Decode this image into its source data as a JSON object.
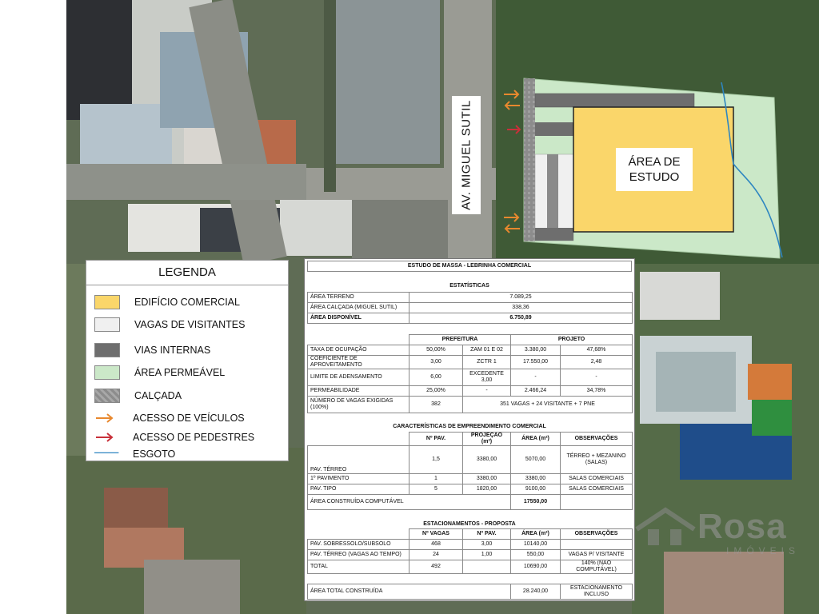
{
  "map": {
    "road_label": "AV. MIGUEL SUTIL",
    "study_area_label_line1": "ÁREA DE",
    "study_area_label_line2": "ESTUDO"
  },
  "colors": {
    "commercial_building": "#FAD66A",
    "visitor_parking": "#F0F0F0",
    "internal_roads": "#6E6E6E",
    "permeable_area": "#CBE8C8",
    "sidewalk": "#8C8C8C",
    "vehicle_access": "#E8882E",
    "pedestrian_access": "#C8303A",
    "sewer": "#2E86C1"
  },
  "legend": {
    "title": "LEGENDA",
    "items": [
      {
        "label": "EDIFÍCIO COMERCIAL",
        "kind": "swatch",
        "color": "#FAD66A"
      },
      {
        "label": "VAGAS DE VISITANTES",
        "kind": "swatch",
        "color": "#F0F0F0"
      },
      {
        "label": "VIAS INTERNAS",
        "kind": "swatch",
        "color": "#6E6E6E"
      },
      {
        "label": "ÁREA PERMEÁVEL",
        "kind": "swatch",
        "color": "#CBE8C8"
      },
      {
        "label": "CALÇADA",
        "kind": "swatch",
        "color": "#8C8C8C"
      },
      {
        "label": "ACESSO DE VEÍCULOS",
        "kind": "arrow",
        "color": "#E8882E",
        "icon": "orange-arrow-icon"
      },
      {
        "label": "ACESSO DE PEDESTRES",
        "kind": "arrow",
        "color": "#C8303A",
        "icon": "red-arrow-icon"
      },
      {
        "label": "ESGOTO",
        "kind": "line",
        "color": "#2E86C1",
        "icon": "blue-line-icon"
      }
    ]
  },
  "study": {
    "title": "ESTUDO DE MASSA - LEBRINHA COMERCIAL",
    "stats_title": "ESTATÍSTICAS",
    "stats": [
      {
        "label": "ÁREA TERRENO",
        "value": "7.089,25"
      },
      {
        "label": "ÁREA CALÇADA (MIGUEL SUTIL)",
        "value": "338,36"
      },
      {
        "label": "ÁREA DISPONÍVEL",
        "value": "6.750,89"
      }
    ],
    "params_headers": {
      "prefeitura": "PREFEITURA",
      "projeto": "PROJETO"
    },
    "params": [
      {
        "label": "TAXA DE OCUPAÇÃO",
        "p1": "50,00%",
        "p2": "ZAM 01 E 02",
        "r1": "3.380,00",
        "r2": "47,68%"
      },
      {
        "label": "COEFICIENTE DE APROVEITAMENTO",
        "p1": "3,00",
        "p2": "ZCTR 1",
        "r1": "17.550,00",
        "r2": "2,48"
      },
      {
        "label": "LIMITE DE ADENSAMENTO",
        "p1": "6,00",
        "p2": "EXCEDENTE 3,00",
        "r1": "-",
        "r2": "-"
      },
      {
        "label": "PERMEABILIDADE",
        "p1": "25,00%",
        "p2": "-",
        "r1": "2.466,24",
        "r2": "34,78%"
      },
      {
        "label": "NÚMERO DE VAGAS EXIGIDAS (100%)",
        "p1": "382",
        "p2": "",
        "r1": "351 VAGAS + 24 VISITANTE + 7 PNE",
        "r2": ""
      }
    ],
    "caract_title": "CARACTERÍSTICAS DE EMPREENDIMENTO COMERCIAL",
    "caract_headers": [
      "Nº PAV.",
      "PROJEÇÃO (m²)",
      "ÁREA  (m²)",
      "OBSERVAÇÕES"
    ],
    "caract": [
      {
        "label": "PAV. TÉRREO",
        "npav": "1,5",
        "proj": "3380,00",
        "area": "5070,00",
        "obs": "TÉRREO + MEZANINO (SALAS)"
      },
      {
        "label": "1º PAVIMENTO",
        "npav": "1",
        "proj": "3380,00",
        "area": "3380,00",
        "obs": "SALAS COMERCIAIS"
      },
      {
        "label": "PAV. TIPO",
        "npav": "5",
        "proj": "1820,00",
        "area": "9100,00",
        "obs": "SALAS COMERCIAIS"
      }
    ],
    "caract_total_label": "ÁREA CONSTRUÍDA COMPUTÁVEL",
    "caract_total_value": "17550,00",
    "estac_title": "ESTACIONAMENTOS - PROPOSTA",
    "estac_headers": [
      "Nº VAGAS",
      "Nº PAV.",
      "ÁREA  (m²)",
      "OBSERVAÇÕES"
    ],
    "estac": [
      {
        "label": "PAV. SOBRESSOLO/SUBSOLO",
        "vagas": "468",
        "npav": "3,00",
        "area": "10140,00",
        "obs": ""
      },
      {
        "label": "PAV. TÉRREO (VAGAS AO TEMPO)",
        "vagas": "24",
        "npav": "1,00",
        "area": "550,00",
        "obs": "VAGAS P/ VISITANTE"
      },
      {
        "label": "TOTAL",
        "vagas": "492",
        "npav": "",
        "area": "10690,00",
        "obs": "140% (NÃO COMPUTÁVEL)"
      }
    ],
    "total_label": "ÁREA TOTAL CONSTRUÍDA",
    "total_value": "28.240,00",
    "total_obs": "ESTACIONAMENTO INCLUSO"
  },
  "watermark": {
    "brand": "Rosa",
    "sub": "IMÓVEIS"
  }
}
